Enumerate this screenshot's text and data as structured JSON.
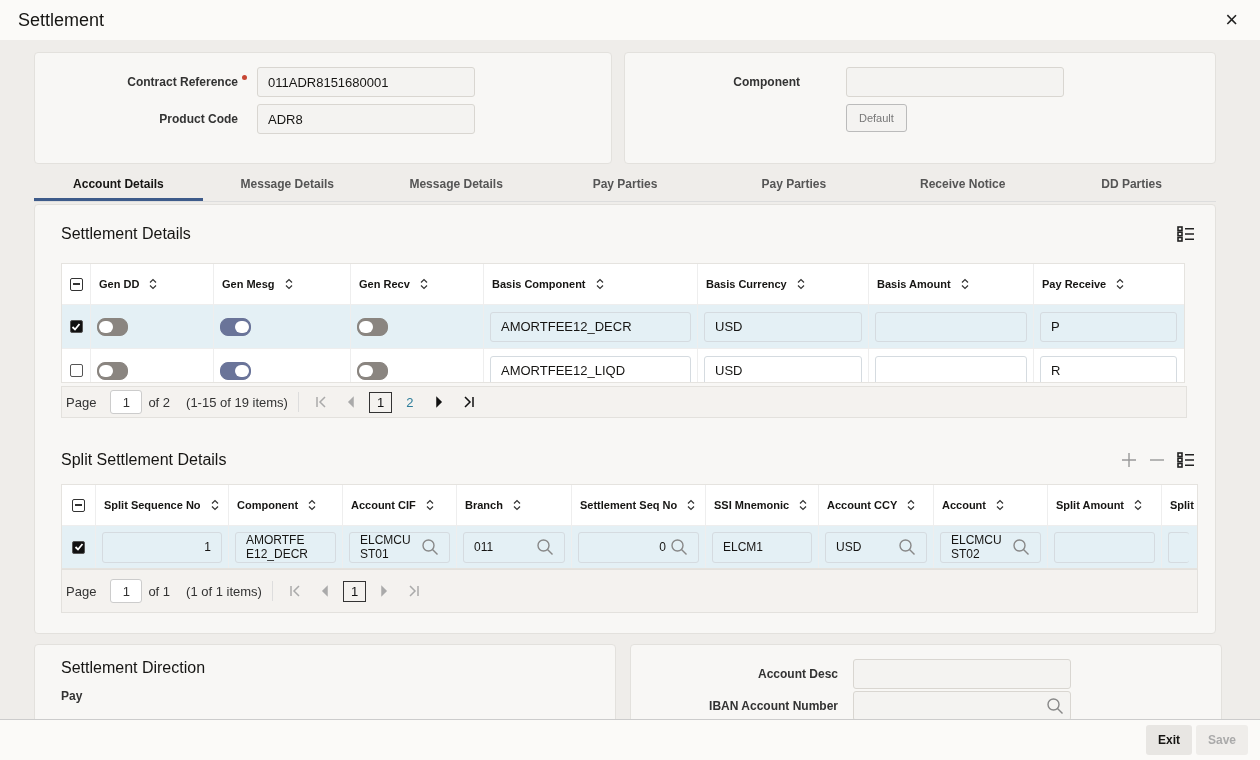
{
  "window": {
    "title": "Settlement",
    "close": "×"
  },
  "contract": {
    "fields": [
      {
        "label": "Contract Reference",
        "required": true,
        "value": "011ADR8151680001"
      },
      {
        "label": "Product Code",
        "required": false,
        "value": "ADR8"
      }
    ]
  },
  "component": {
    "label": "Component",
    "button": "Default"
  },
  "tabs": [
    {
      "label": "Account Details",
      "selected": true
    },
    {
      "label": "Message Details",
      "selected": false
    },
    {
      "label": "Message Details",
      "selected": false
    },
    {
      "label": "Pay Parties",
      "selected": false
    },
    {
      "label": "Pay Parties",
      "selected": false
    },
    {
      "label": "Receive Notice",
      "selected": false
    },
    {
      "label": "DD Parties",
      "selected": false
    }
  ],
  "settlement_details": {
    "title": "Settlement Details",
    "select_all": {
      "checked": true,
      "indeterminate": true
    },
    "columns": [
      "Gen DD",
      "Gen Mesg",
      "Gen Recv",
      "Basis Component",
      "Basis Currency",
      "Basis Amount",
      "Pay Receive"
    ],
    "rows": [
      {
        "selected": true,
        "cells": [
          {
            "kind": "toggle",
            "on": false
          },
          {
            "kind": "toggle",
            "on": true
          },
          {
            "kind": "toggle",
            "on": false
          },
          {
            "kind": "field",
            "value": "AMORTFEE12_DECR"
          },
          {
            "kind": "field",
            "value": "USD"
          },
          {
            "kind": "field"
          },
          {
            "kind": "field",
            "value": "P"
          }
        ]
      },
      {
        "selected": false,
        "cells": [
          {
            "kind": "toggle",
            "on": false
          },
          {
            "kind": "toggle",
            "on": true
          },
          {
            "kind": "toggle",
            "on": false
          },
          {
            "kind": "field",
            "value": "AMORTFEE12_LIQD"
          },
          {
            "kind": "field",
            "value": "USD"
          },
          {
            "kind": "field"
          },
          {
            "kind": "field",
            "value": "R"
          }
        ]
      }
    ],
    "pager": {
      "label": "Page",
      "page": "1",
      "of": "of 2",
      "summary": "(1-15 of 19 items)",
      "nav_before": [
        {
          "kind": "first",
          "disabled": true
        },
        {
          "kind": "prev",
          "disabled": true
        }
      ],
      "pages": [
        {
          "label": "1",
          "selected": true
        },
        {
          "label": "2",
          "selected": false
        }
      ],
      "nav_after": [
        {
          "kind": "next",
          "disabled": false
        },
        {
          "kind": "last",
          "disabled": false
        }
      ]
    }
  },
  "split_settlement_details": {
    "title": "Split Settlement Details",
    "select_all": {
      "checked": true,
      "indeterminate": true
    },
    "columns": [
      "Split Sequence No",
      "Component",
      "Account CIF",
      "Branch",
      "Settlement Seq No",
      "SSI Mnemonic",
      "Account CCY",
      "Account",
      "Split Amount",
      "Split"
    ],
    "rows": [
      {
        "selected": true,
        "cells": [
          {
            "kind": "number",
            "value": "1"
          },
          {
            "kind": "field",
            "value": "AMORTFEE12_DECR"
          },
          {
            "kind": "lookup",
            "value": "ELCMCUST01"
          },
          {
            "kind": "lookup",
            "value": "011"
          },
          {
            "kind": "number_lookup",
            "value": "0"
          },
          {
            "kind": "field",
            "value": "ELCM1"
          },
          {
            "kind": "lookup",
            "value": "USD"
          },
          {
            "kind": "lookup",
            "value": "ELCMCUST02"
          },
          {
            "kind": "field"
          },
          {
            "kind": "field"
          }
        ]
      }
    ],
    "pager": {
      "label": "Page",
      "page": "1",
      "of": "of 1",
      "summary": "(1 of 1 items)",
      "nav_before": [
        {
          "kind": "first",
          "disabled": true
        },
        {
          "kind": "prev",
          "disabled": true
        }
      ],
      "pages": [
        {
          "label": "1",
          "selected": true
        }
      ],
      "nav_after": [
        {
          "kind": "next",
          "disabled": true
        },
        {
          "kind": "last",
          "disabled": true
        }
      ]
    }
  },
  "settlement_direction": {
    "title": "Settlement Direction",
    "label": "Pay"
  },
  "account": {
    "fields": [
      {
        "label": "Account Desc",
        "kind": "text"
      },
      {
        "label": "IBAN Account Number",
        "kind": "lookup"
      }
    ]
  },
  "footer": {
    "buttons": [
      {
        "label": "Exit",
        "disabled": false
      },
      {
        "label": "Save",
        "disabled": true
      }
    ]
  }
}
